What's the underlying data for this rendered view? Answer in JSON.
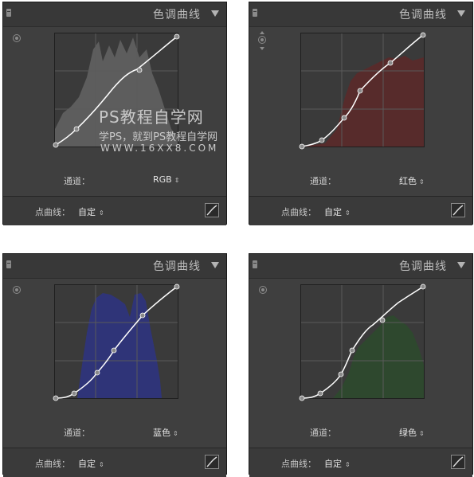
{
  "panels": [
    {
      "title": "色调曲线",
      "channel_label": "通道：",
      "channel_value": "RGB",
      "point_curve_label": "点曲线：",
      "point_curve_value": "自定",
      "histogram_color": "#6a6a6a"
    },
    {
      "title": "色调曲线",
      "channel_label": "通道：",
      "channel_value": "红色",
      "point_curve_label": "点曲线：",
      "point_curve_value": "自定",
      "histogram_color": "#5b2a2a"
    },
    {
      "title": "色调曲线",
      "channel_label": "通道：",
      "channel_value": "蓝色",
      "point_curve_label": "点曲线：",
      "point_curve_value": "自定",
      "histogram_color": "#2f3480"
    },
    {
      "title": "色调曲线",
      "channel_label": "通道：",
      "channel_value": "绿色",
      "point_curve_label": "点曲线：",
      "point_curve_value": "自定",
      "histogram_color": "#2d4a2d"
    }
  ],
  "up_down_glyph": "⇕",
  "watermark": {
    "title": "PS教程自学网",
    "subtitle": "学PS，就到PS教程自学网",
    "url": "WWW.16XX8.COM"
  },
  "colors": {
    "panel_bg": "#3f3f3f",
    "graph_bg": "#3a3a3a",
    "curve": "#ffffff",
    "gridline": "#5a5a5a"
  }
}
